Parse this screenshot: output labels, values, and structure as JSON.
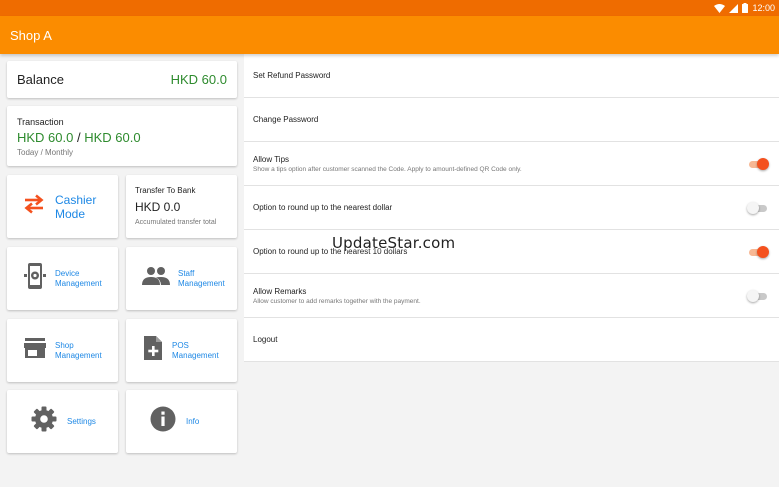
{
  "status_bar": {
    "time": "12:00",
    "icons": [
      "wifi-icon",
      "signal-icon",
      "battery-icon"
    ]
  },
  "app_bar": {
    "title": "Shop A"
  },
  "balance": {
    "label": "Balance",
    "value": "HKD 60.0"
  },
  "transaction": {
    "label": "Transaction",
    "today": "HKD 60.0",
    "separator": " / ",
    "monthly": "HKD 60.0",
    "period_label": "Today / Monthly"
  },
  "cashier": {
    "line1": "Cashier",
    "line2": "Mode",
    "icon": "swap-arrows-icon"
  },
  "transfer": {
    "label": "Transfer To Bank",
    "value": "HKD 0.0",
    "sub": "Accumulated transfer total"
  },
  "tiles": {
    "device": {
      "line1": "Device",
      "line2": "Management",
      "icon": "phone-settings-icon"
    },
    "staff": {
      "line1": "Staff",
      "line2": "Management",
      "icon": "people-icon"
    },
    "shop": {
      "line1": "Shop",
      "line2": "Management",
      "icon": "store-icon"
    },
    "pos": {
      "line1": "POS",
      "line2": "Management",
      "icon": "document-add-icon"
    },
    "settings": {
      "label": "Settings",
      "icon": "gear-icon"
    },
    "info": {
      "label": "Info",
      "icon": "info-icon"
    }
  },
  "settings_list": {
    "refund_password": {
      "title": "Set Refund Password"
    },
    "change_password": {
      "title": "Change Password"
    },
    "allow_tips": {
      "title": "Allow Tips",
      "desc": "Show a tips option after customer scanned the Code. Apply to amount-defined QR Code only.",
      "on": true
    },
    "round_dollar": {
      "title": "Option to round up to the nearest dollar",
      "on": false
    },
    "round_10": {
      "title": "Option to round up to the nearest 10 dollars",
      "on": true
    },
    "allow_remarks": {
      "title": "Allow Remarks",
      "desc": "Allow customer to add remarks together with the payment.",
      "on": false
    },
    "logout": {
      "title": "Logout"
    }
  },
  "watermark": "UpdateStar.com",
  "colors": {
    "primary": "#fb8c00",
    "status": "#ef6c00",
    "accent": "#f4511e",
    "link": "#1e88e5",
    "money": "#2e8b2e"
  }
}
